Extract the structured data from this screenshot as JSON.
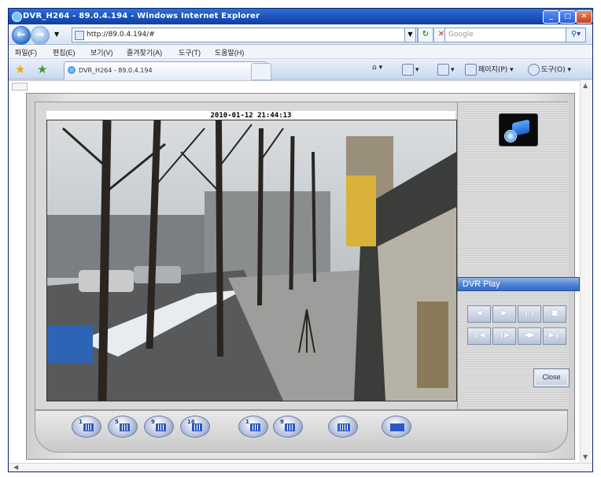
{
  "window": {
    "title": "DVR_H264 - 89.0.4.194 - Windows Internet Explorer",
    "controls": [
      "_",
      "□",
      "✕"
    ]
  },
  "address_bar": {
    "url": "http://89.0.4.194/#",
    "search_placeholder": "Google"
  },
  "menu": {
    "items": [
      "파일(F)",
      "편집(E)",
      "보기(V)",
      "즐겨찾기(A)",
      "도구(T)",
      "도움말(H)"
    ]
  },
  "tabs": {
    "active_label": "DVR_H264 - 89.0.4.194"
  },
  "toolbar": {
    "page_label": "페이지(P)",
    "tools_label": "도구(O)"
  },
  "dvr": {
    "timestamp": "2010-01-12 21:44:13",
    "play_label": "DVR Play",
    "close_label": "Close",
    "playback_icons": [
      "rewind-icon",
      "play-icon",
      "pause-icon",
      "stop-icon"
    ],
    "step_icons": [
      "step-back-icon",
      "step-forward-icon",
      "slow-icon",
      "fast-icon"
    ],
    "layout_buttons": [
      {
        "label": "1",
        "icon": "single-view-icon"
      },
      {
        "label": "5",
        "icon": "grid-5-icon"
      },
      {
        "label": "9",
        "icon": "grid-9-icon"
      },
      {
        "label": "16",
        "icon": "grid-16-icon"
      },
      {
        "label": "1",
        "icon": "single-view-icon"
      },
      {
        "label": "9",
        "icon": "grid-9-icon"
      },
      {
        "label": "",
        "icon": "full-grid-icon"
      },
      {
        "label": "",
        "icon": "camera-settings-icon"
      }
    ]
  }
}
